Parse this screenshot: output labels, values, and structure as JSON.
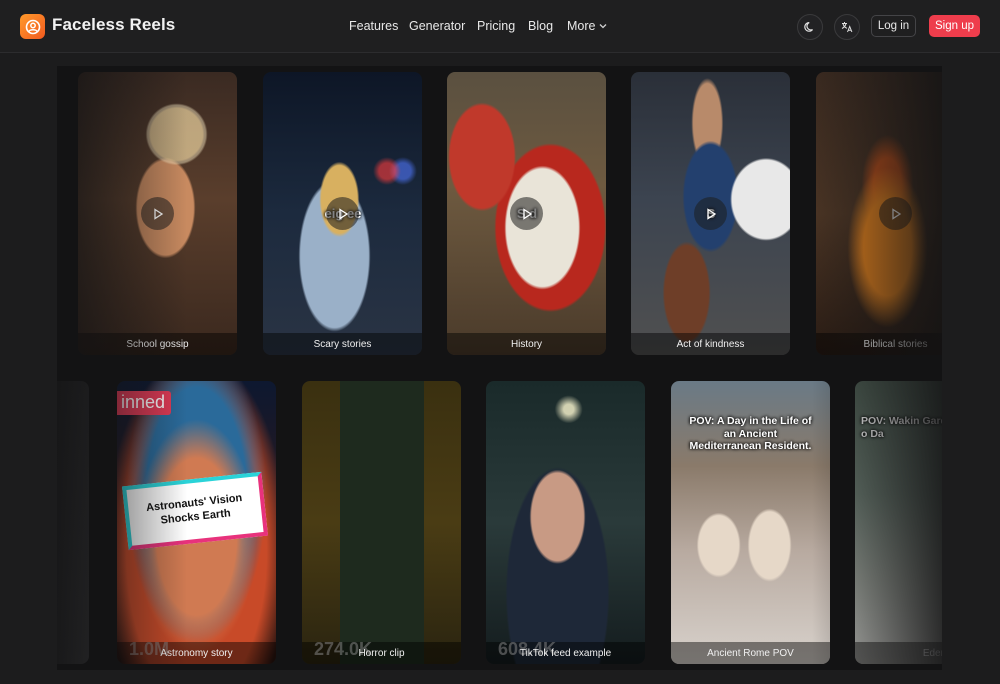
{
  "header": {
    "brand": "Faceless Reels",
    "nav": [
      "Features",
      "Generator",
      "Pricing",
      "Blog",
      "More"
    ],
    "login_label": "Log in",
    "signup_label": "Sign up"
  },
  "icons": {
    "logo": "user-circle-icon",
    "theme": "moon-icon",
    "language": "translate-icon",
    "more": "chevron-down-icon",
    "play": "play-icon"
  },
  "colors": {
    "accent": "#ee3d4c",
    "logo_start": "#ff9a2b",
    "logo_end": "#f25a1f",
    "background": "#1c1c1d"
  },
  "row1": [
    {
      "caption": "School gossip",
      "overlay": ""
    },
    {
      "caption": "Scary stories",
      "overlay": "eig      ee"
    },
    {
      "caption": "History",
      "overlay": "S         d"
    },
    {
      "caption": "Act of kindness",
      "overlay": "S"
    },
    {
      "caption": "Biblical stories",
      "overlay": ""
    }
  ],
  "row2": [
    {
      "caption": "Astronomy story",
      "views": "1.0M",
      "badge": "inned",
      "headline": "Astronauts' Vision Shocks Earth"
    },
    {
      "caption": "Horror clip",
      "views": "274.0K"
    },
    {
      "caption": "TikTok feed example",
      "views": "608.4K"
    },
    {
      "caption": "Ancient Rome POV",
      "headline": "POV: A Day in the Life of an Ancient Mediterranean Resident."
    },
    {
      "caption": "Eden",
      "headline": "POV: Wakin Garden o Da"
    }
  ]
}
